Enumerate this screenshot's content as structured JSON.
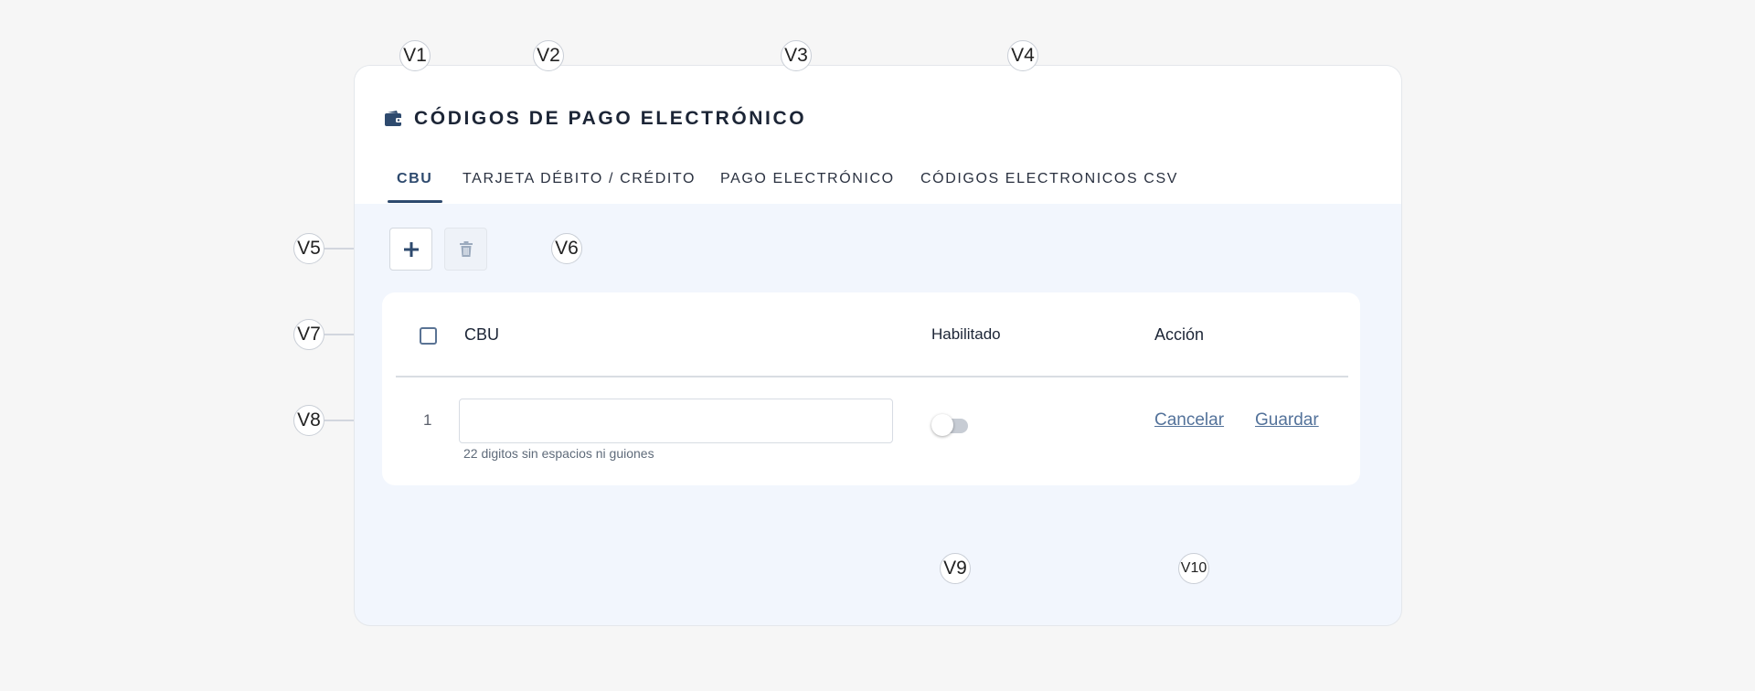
{
  "section": {
    "title": "CÓDIGOS DE PAGO ELECTRÓNICO",
    "icon": "wallet-icon"
  },
  "tabs": [
    {
      "label": "CBU",
      "active": true
    },
    {
      "label": "TARJETA DÉBITO / CRÉDITO",
      "active": false
    },
    {
      "label": "PAGO ELECTRÓNICO",
      "active": false
    },
    {
      "label": "CÓDIGOS ELECTRONICOS CSV",
      "active": false
    }
  ],
  "toolbar": {
    "add_icon": "plus-icon",
    "delete_icon": "trash-icon"
  },
  "table": {
    "headers": {
      "cbu": "CBU",
      "enabled": "Habilitado",
      "action": "Acción"
    },
    "rows": [
      {
        "number": "1",
        "cbu_value": "",
        "hint": "22 digitos sin espacios ni guiones",
        "enabled": false,
        "cancel_label": "Cancelar",
        "save_label": "Guardar"
      }
    ]
  },
  "callouts": [
    "V1",
    "V2",
    "V3",
    "V4",
    "V5",
    "V6",
    "V7",
    "V8",
    "V9",
    "V10"
  ],
  "colors": {
    "accent": "#2e4a6e",
    "link": "#53729a",
    "page_bg": "#f6f6f6",
    "panel_bg": "#f2f6fd"
  }
}
